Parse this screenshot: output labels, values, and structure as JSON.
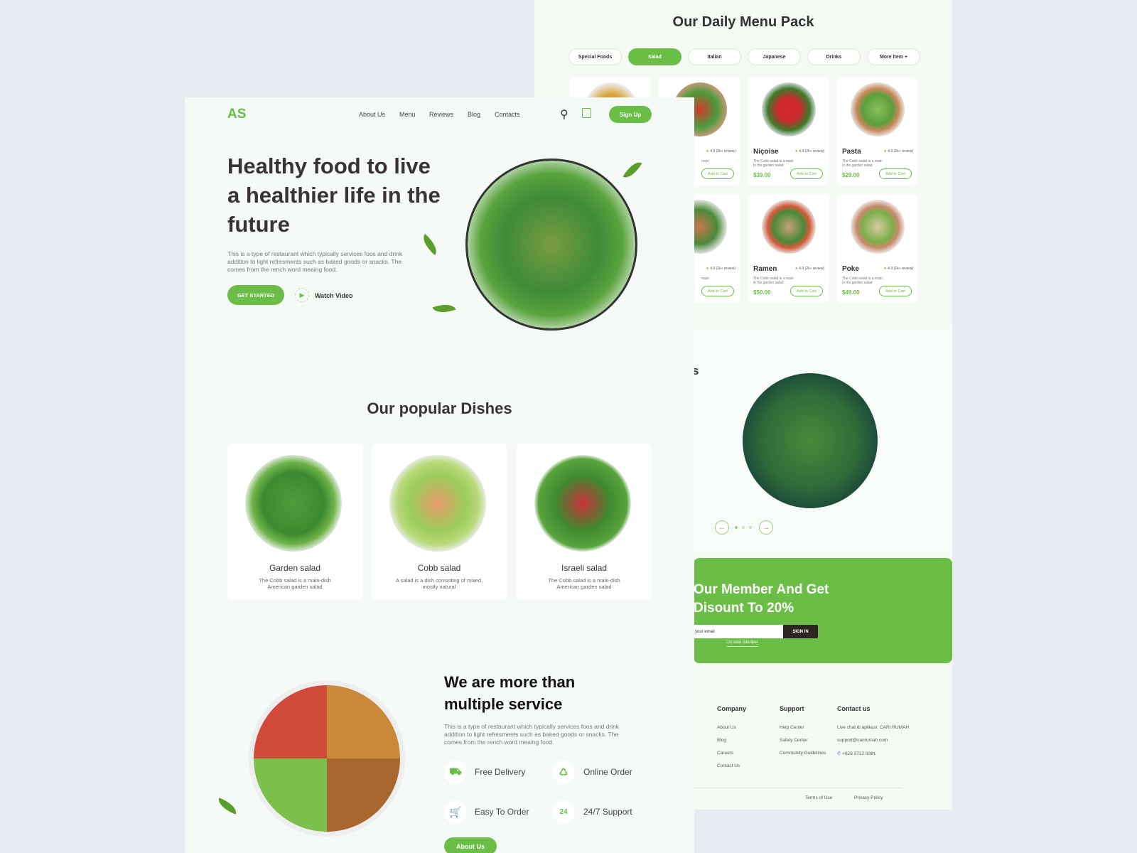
{
  "menu_page": {
    "title": "Our Daily Menu Pack",
    "tabs": [
      {
        "label": "Special Foods",
        "active": false
      },
      {
        "label": "Salad",
        "active": true
      },
      {
        "label": "Italian",
        "active": false
      },
      {
        "label": "Japanese",
        "active": false
      },
      {
        "label": "Drinks",
        "active": false
      },
      {
        "label": "More Item +",
        "active": false
      }
    ],
    "items": [
      {
        "name": "Niçoise",
        "rating": "4.9 (2k+ review)",
        "desc": "The Cobb salad is a main in the garden salad",
        "price": "$39.00",
        "cta": "Add to Cart"
      },
      {
        "name": "Pasta",
        "rating": "4.9 (2k+ review)",
        "desc": "The Cobb salad is a main in the garden salad",
        "price": "$29.00",
        "cta": "Add to Cart"
      },
      {
        "name": "Ramen",
        "rating": "4.9 (2k+ review)",
        "desc": "The Cobb salad is a main in the garden salad",
        "price": "$50.00",
        "cta": "Add to Cart"
      },
      {
        "name": "Poke",
        "rating": "4.9 (2k+ review)",
        "desc": "The Cobb salad is a main in the garden salad",
        "price": "$49.00",
        "cta": "Add to Cart"
      }
    ],
    "partial_items": [
      {
        "rating": "4.9 (2k+ review)",
        "desc": "main",
        "cta": "Add to Cart"
      },
      {
        "rating": "4.9 (2k+ review)",
        "desc": "main",
        "cta": "Add to Cart"
      }
    ],
    "carousel": {
      "heading_fragment": "s",
      "prev": "←",
      "next": "→"
    },
    "promo": {
      "title_line1": "Our Member And Get",
      "title_line2": "Disount To 20%",
      "email_placeholder": "your email",
      "signin": "SIGN IN",
      "new_member": "I,m new member"
    },
    "footer": {
      "company": {
        "title": "Company",
        "links": [
          "About Us",
          "Blog",
          "Careers",
          "Contact Us"
        ]
      },
      "support": {
        "title": "Support",
        "links": [
          "Help Center",
          "Safety Center",
          "Community Guidelines"
        ]
      },
      "contact": {
        "title": "Contact us",
        "lines": [
          "Live chat di aplikasi: CARI RUMAH",
          "support@carirumah.com",
          "+628 3712 9381"
        ]
      },
      "terms": "Terms of Use",
      "privacy": "Privacy Policy"
    }
  },
  "home_page": {
    "logo": "AS",
    "nav": [
      "About Us",
      "Menu",
      "Reviews",
      "Blog",
      "Contacts"
    ],
    "signup": "Sign Up",
    "hero": {
      "title": "Healthy food to live a healthier life in the future",
      "desc": "This is a type of restaurant which typically services foos and drink addition to light refresments such as baked goods or snacks. The comes from the rench word meaing food.",
      "cta": "GET STARTED",
      "watch": "Watch Video"
    },
    "popular": {
      "title": "Our popular Dishes",
      "dishes": [
        {
          "name": "Garden salad",
          "desc": "The Cobb salad is a main-dish American garden salad"
        },
        {
          "name": "Cobb salad",
          "desc": "A salad is a dish consisting of mixed, mostly natural"
        },
        {
          "name": "Israeli salad",
          "desc": "The Cobb salad is a main-dish American garden salad"
        }
      ]
    },
    "services": {
      "title": "We are more than multiple service",
      "desc": "This is a type of restaurant which typically services foos and drink addition to light refresments such as baked goods or snacks. The comes from the rench word meaing food.",
      "items": [
        "Free Delivery",
        "Online Order",
        "Easy To Order",
        "24/7 Support"
      ],
      "cta": "About Us"
    }
  },
  "colors": {
    "accent": "#6abd45",
    "dark": "#2d2424",
    "background": "#e8ebf2"
  }
}
